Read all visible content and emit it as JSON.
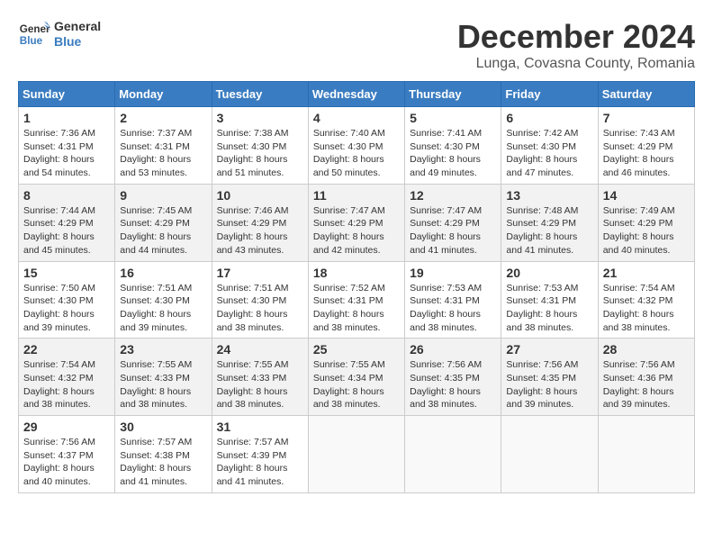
{
  "header": {
    "logo_line1": "General",
    "logo_line2": "Blue",
    "month_title": "December 2024",
    "location": "Lunga, Covasna County, Romania"
  },
  "weekdays": [
    "Sunday",
    "Monday",
    "Tuesday",
    "Wednesday",
    "Thursday",
    "Friday",
    "Saturday"
  ],
  "weeks": [
    [
      {
        "day": "1",
        "sunrise": "7:36 AM",
        "sunset": "4:31 PM",
        "daylight": "8 hours and 54 minutes."
      },
      {
        "day": "2",
        "sunrise": "7:37 AM",
        "sunset": "4:31 PM",
        "daylight": "8 hours and 53 minutes."
      },
      {
        "day": "3",
        "sunrise": "7:38 AM",
        "sunset": "4:30 PM",
        "daylight": "8 hours and 51 minutes."
      },
      {
        "day": "4",
        "sunrise": "7:40 AM",
        "sunset": "4:30 PM",
        "daylight": "8 hours and 50 minutes."
      },
      {
        "day": "5",
        "sunrise": "7:41 AM",
        "sunset": "4:30 PM",
        "daylight": "8 hours and 49 minutes."
      },
      {
        "day": "6",
        "sunrise": "7:42 AM",
        "sunset": "4:30 PM",
        "daylight": "8 hours and 47 minutes."
      },
      {
        "day": "7",
        "sunrise": "7:43 AM",
        "sunset": "4:29 PM",
        "daylight": "8 hours and 46 minutes."
      }
    ],
    [
      {
        "day": "8",
        "sunrise": "7:44 AM",
        "sunset": "4:29 PM",
        "daylight": "8 hours and 45 minutes."
      },
      {
        "day": "9",
        "sunrise": "7:45 AM",
        "sunset": "4:29 PM",
        "daylight": "8 hours and 44 minutes."
      },
      {
        "day": "10",
        "sunrise": "7:46 AM",
        "sunset": "4:29 PM",
        "daylight": "8 hours and 43 minutes."
      },
      {
        "day": "11",
        "sunrise": "7:47 AM",
        "sunset": "4:29 PM",
        "daylight": "8 hours and 42 minutes."
      },
      {
        "day": "12",
        "sunrise": "7:47 AM",
        "sunset": "4:29 PM",
        "daylight": "8 hours and 41 minutes."
      },
      {
        "day": "13",
        "sunrise": "7:48 AM",
        "sunset": "4:29 PM",
        "daylight": "8 hours and 41 minutes."
      },
      {
        "day": "14",
        "sunrise": "7:49 AM",
        "sunset": "4:29 PM",
        "daylight": "8 hours and 40 minutes."
      }
    ],
    [
      {
        "day": "15",
        "sunrise": "7:50 AM",
        "sunset": "4:30 PM",
        "daylight": "8 hours and 39 minutes."
      },
      {
        "day": "16",
        "sunrise": "7:51 AM",
        "sunset": "4:30 PM",
        "daylight": "8 hours and 39 minutes."
      },
      {
        "day": "17",
        "sunrise": "7:51 AM",
        "sunset": "4:30 PM",
        "daylight": "8 hours and 38 minutes."
      },
      {
        "day": "18",
        "sunrise": "7:52 AM",
        "sunset": "4:31 PM",
        "daylight": "8 hours and 38 minutes."
      },
      {
        "day": "19",
        "sunrise": "7:53 AM",
        "sunset": "4:31 PM",
        "daylight": "8 hours and 38 minutes."
      },
      {
        "day": "20",
        "sunrise": "7:53 AM",
        "sunset": "4:31 PM",
        "daylight": "8 hours and 38 minutes."
      },
      {
        "day": "21",
        "sunrise": "7:54 AM",
        "sunset": "4:32 PM",
        "daylight": "8 hours and 38 minutes."
      }
    ],
    [
      {
        "day": "22",
        "sunrise": "7:54 AM",
        "sunset": "4:32 PM",
        "daylight": "8 hours and 38 minutes."
      },
      {
        "day": "23",
        "sunrise": "7:55 AM",
        "sunset": "4:33 PM",
        "daylight": "8 hours and 38 minutes."
      },
      {
        "day": "24",
        "sunrise": "7:55 AM",
        "sunset": "4:33 PM",
        "daylight": "8 hours and 38 minutes."
      },
      {
        "day": "25",
        "sunrise": "7:55 AM",
        "sunset": "4:34 PM",
        "daylight": "8 hours and 38 minutes."
      },
      {
        "day": "26",
        "sunrise": "7:56 AM",
        "sunset": "4:35 PM",
        "daylight": "8 hours and 38 minutes."
      },
      {
        "day": "27",
        "sunrise": "7:56 AM",
        "sunset": "4:35 PM",
        "daylight": "8 hours and 39 minutes."
      },
      {
        "day": "28",
        "sunrise": "7:56 AM",
        "sunset": "4:36 PM",
        "daylight": "8 hours and 39 minutes."
      }
    ],
    [
      {
        "day": "29",
        "sunrise": "7:56 AM",
        "sunset": "4:37 PM",
        "daylight": "8 hours and 40 minutes."
      },
      {
        "day": "30",
        "sunrise": "7:57 AM",
        "sunset": "4:38 PM",
        "daylight": "8 hours and 41 minutes."
      },
      {
        "day": "31",
        "sunrise": "7:57 AM",
        "sunset": "4:39 PM",
        "daylight": "8 hours and 41 minutes."
      },
      null,
      null,
      null,
      null
    ]
  ],
  "labels": {
    "sunrise": "Sunrise:",
    "sunset": "Sunset:",
    "daylight": "Daylight:"
  }
}
